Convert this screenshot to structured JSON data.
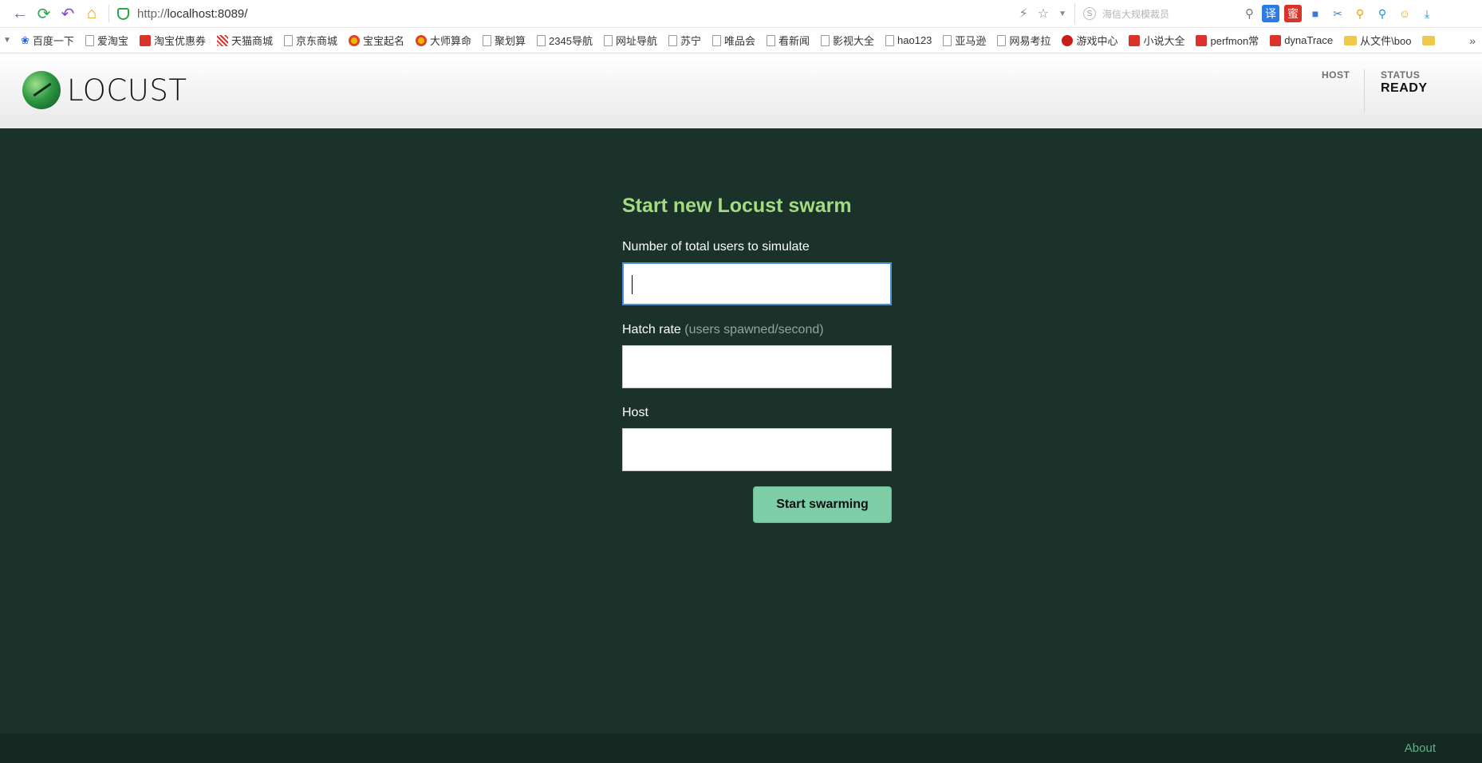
{
  "browser": {
    "url_proto": "http://",
    "url_host": "localhost:8089/",
    "search_placeholder": "海信大规模裁员"
  },
  "bookmarks": [
    {
      "label": "百度一下",
      "icon": "paw"
    },
    {
      "label": "爱淘宝",
      "icon": "doc"
    },
    {
      "label": "淘宝优惠券",
      "icon": "red"
    },
    {
      "label": "天猫商城",
      "icon": "tmall"
    },
    {
      "label": "京东商城",
      "icon": "doc"
    },
    {
      "label": "宝宝起名",
      "icon": "yin"
    },
    {
      "label": "大师算命",
      "icon": "yin"
    },
    {
      "label": "聚划算",
      "icon": "doc"
    },
    {
      "label": "2345导航",
      "icon": "doc"
    },
    {
      "label": "网址导航",
      "icon": "doc"
    },
    {
      "label": "苏宁",
      "icon": "doc"
    },
    {
      "label": "唯品会",
      "icon": "doc"
    },
    {
      "label": "看新闻",
      "icon": "doc"
    },
    {
      "label": "影视大全",
      "icon": "doc"
    },
    {
      "label": "hao123",
      "icon": "doc"
    },
    {
      "label": "亚马逊",
      "icon": "doc"
    },
    {
      "label": "网易考拉",
      "icon": "doc"
    },
    {
      "label": "游戏中心",
      "icon": "redc"
    },
    {
      "label": "小说大全",
      "icon": "red"
    },
    {
      "label": "perfmon常",
      "icon": "red"
    },
    {
      "label": "dynaTrace",
      "icon": "red"
    },
    {
      "label": "从文件\\boo",
      "icon": "folder"
    },
    {
      "label": "",
      "icon": "folder"
    }
  ],
  "header": {
    "logo_text": "LOCUST",
    "host_label": "HOST",
    "host_value": "",
    "status_label": "STATUS",
    "status_value": "READY"
  },
  "form": {
    "title": "Start new Locust swarm",
    "users_label": "Number of total users to simulate",
    "users_value": "",
    "hatch_label": "Hatch rate",
    "hatch_hint": "(users spawned/second)",
    "hatch_value": "",
    "host_label": "Host",
    "host_value": "",
    "submit_label": "Start swarming"
  },
  "footer": {
    "about_label": "About"
  },
  "colors": {
    "background": "#1a3229",
    "title": "#a4db81",
    "button": "#7dcda7",
    "footer": "#142821",
    "about_link": "#5fb28a"
  }
}
